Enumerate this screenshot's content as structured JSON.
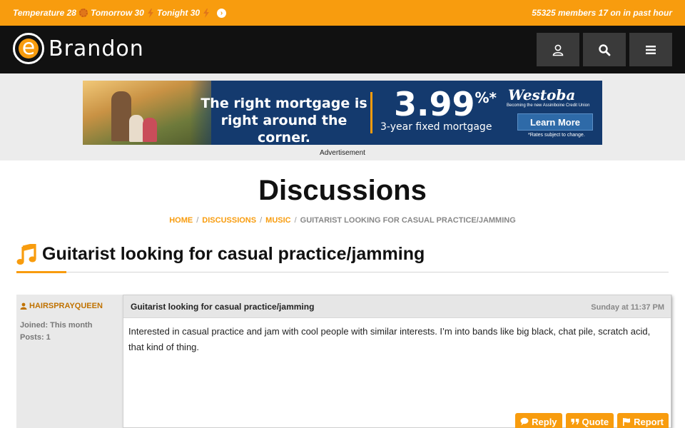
{
  "topbar": {
    "temperature_label": "Temperature 28",
    "tomorrow_label": "Tomorrow 30",
    "tonight_label": "Tonight 30",
    "members_text": "55325 members 17 on in past hour",
    "bar_color": "#f89c0e"
  },
  "header": {
    "logo_letter": "e",
    "brand_name": "Brandon",
    "icons": [
      "user-icon",
      "search-icon",
      "menu-icon"
    ]
  },
  "ad": {
    "headline": "The right mortgage is right around the corner.",
    "rate": "3.99",
    "rate_suffix": "%*",
    "subline": "3-year fixed mortgage",
    "bank_name": "Westoba",
    "bank_tagline": "Becoming the new Assiniboine Credit Union",
    "cta": "Learn More",
    "fine_print": "*Rates subject to change.",
    "caption": "Advertisement"
  },
  "page": {
    "title": "Discussions"
  },
  "breadcrumb": {
    "home": "HOME",
    "discussions": "DISCUSSIONS",
    "music": "MUSIC",
    "current": "GUITARIST LOOKING FOR CASUAL PRACTICE/JAMMING",
    "separator": "/"
  },
  "thread": {
    "title": "Guitarist looking for casual practice/jamming",
    "icon": "music-note-icon"
  },
  "post": {
    "author": "HAIRSPRAYQUEEN",
    "joined": "Joined: This month",
    "posts": "Posts: 1",
    "subject": "Guitarist looking for casual practice/jamming",
    "time": "Sunday at 11:37 PM",
    "body": "Interested in casual practice and jam with cool people with similar interests. I’m into bands like big black, chat pile, scratch acid, that kind of thing.",
    "actions": {
      "reply": "Reply",
      "quote": "Quote",
      "report": "Report"
    }
  }
}
